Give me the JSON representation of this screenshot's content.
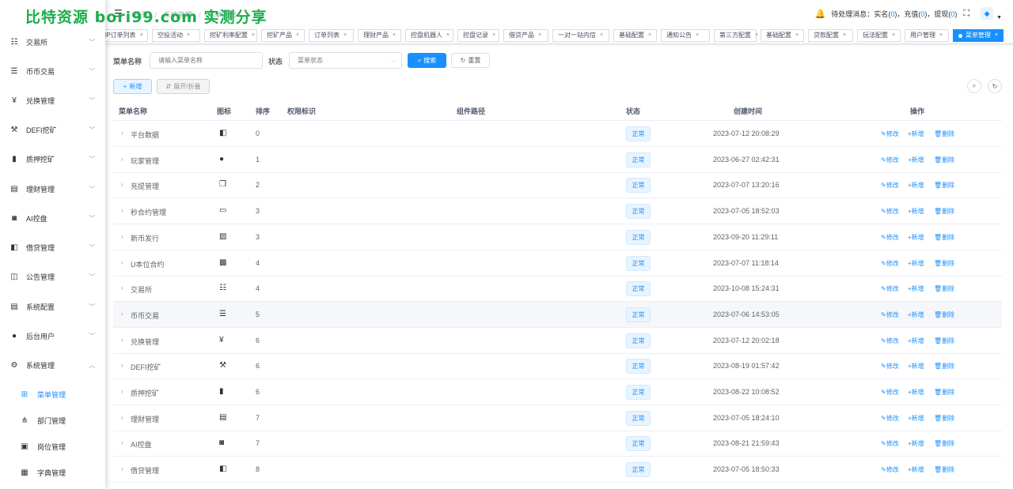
{
  "watermark": "比特资源 bori99.com 实测分享",
  "topbar": {
    "breadcrumb": [
      "首页",
      "系统管理",
      "菜单管理"
    ],
    "pending_label": "待处理消息：",
    "realname_label": "实名(",
    "realname_count": "0",
    "recharge_label": "充值(",
    "recharge_count": "0",
    "withdraw_label": "提现(",
    "withdraw_count": "0",
    "avatar_text": "头像"
  },
  "sidebar": {
    "items": [
      {
        "label": "交易所",
        "icon": "list-icon"
      },
      {
        "label": "币币交易",
        "icon": "list-bullet-icon"
      },
      {
        "label": "兑换管理",
        "icon": "yen-icon"
      },
      {
        "label": "DEFI挖矿",
        "icon": "miner-icon"
      },
      {
        "label": "质押挖矿",
        "icon": "bar-chart-icon"
      },
      {
        "label": "理财管理",
        "icon": "document-icon"
      },
      {
        "label": "AI控盘",
        "icon": "robot-icon"
      },
      {
        "label": "借贷管理",
        "icon": "book-icon"
      },
      {
        "label": "公告管理",
        "icon": "open-book-icon"
      },
      {
        "label": "系统配置",
        "icon": "document-icon"
      },
      {
        "label": "后台用户",
        "icon": "user-icon"
      },
      {
        "label": "系统管理",
        "icon": "gear-icon"
      }
    ],
    "sub_items": [
      {
        "label": "菜单管理",
        "icon": "tree-icon"
      },
      {
        "label": "部门管理",
        "icon": "org-icon"
      },
      {
        "label": "岗位管理",
        "icon": "post-icon"
      },
      {
        "label": "字典管理",
        "icon": "dict-icon"
      }
    ]
  },
  "tags": [
    "IP订单列表",
    "空投活动",
    "挖矿利率配置",
    "挖矿产品",
    "订单列表",
    "理财产品",
    "控盘机器人",
    "控盘记录",
    "借贷产品",
    "一对一站内信",
    "基础配置",
    "通知公告",
    "第三方配置",
    "基础配置",
    "贷款配置",
    "玩法配置",
    "用户管理",
    "菜单管理"
  ],
  "filter": {
    "name_label": "菜单名称",
    "name_placeholder": "请输入菜单名称",
    "status_label": "状态",
    "status_placeholder": "菜单状态",
    "search_label": "搜索",
    "reset_label": "重置"
  },
  "toolbar": {
    "add_label": "新增",
    "expand_label": "展开/折叠"
  },
  "table": {
    "headers": [
      "菜单名称",
      "图标",
      "排序",
      "权限标识",
      "组件路径",
      "状态",
      "创建时间",
      "操作"
    ],
    "op_edit": "修改",
    "op_add": "新增",
    "op_delete": "删除",
    "rows": [
      {
        "name": "平台数据",
        "icon": "book-icon",
        "order": "0",
        "status": "正常",
        "created": "2023-07-12 20:08:29"
      },
      {
        "name": "玩家管理",
        "icon": "user-icon",
        "order": "1",
        "status": "正常",
        "created": "2023-06-27 02:42:31"
      },
      {
        "name": "充提管理",
        "icon": "copy-icon",
        "order": "2",
        "status": "正常",
        "created": "2023-07-07 13:20:16"
      },
      {
        "name": "秒合约管理",
        "icon": "monitor-icon",
        "order": "3",
        "status": "正常",
        "created": "2023-07-05 18:52:03"
      },
      {
        "name": "新币发行",
        "icon": "image-icon",
        "order": "3",
        "status": "正常",
        "created": "2023-09-20 11:29:11"
      },
      {
        "name": "U本位合约",
        "icon": "grid-icon",
        "order": "4",
        "status": "正常",
        "created": "2023-07-07 11:18:14"
      },
      {
        "name": "交易所",
        "icon": "list-icon",
        "order": "4",
        "status": "正常",
        "created": "2023-10-08 15:24:31"
      },
      {
        "name": "币币交易",
        "icon": "list-bullet-icon",
        "order": "5",
        "status": "正常",
        "created": "2023-07-06 14:53:05"
      },
      {
        "name": "兑换管理",
        "icon": "yen-icon",
        "order": "6",
        "status": "正常",
        "created": "2023-07-12 20:02:18"
      },
      {
        "name": "DEFI挖矿",
        "icon": "miner-icon",
        "order": "6",
        "status": "正常",
        "created": "2023-08-19 01:57:42"
      },
      {
        "name": "质押挖矿",
        "icon": "bar-chart-icon",
        "order": "6",
        "status": "正常",
        "created": "2023-08-22 10:08:52"
      },
      {
        "name": "理财管理",
        "icon": "document-icon",
        "order": "7",
        "status": "正常",
        "created": "2023-07-05 18:24:10"
      },
      {
        "name": "AI控盘",
        "icon": "robot-icon",
        "order": "7",
        "status": "正常",
        "created": "2023-08-21 21:59:43"
      },
      {
        "name": "借贷管理",
        "icon": "book-icon",
        "order": "8",
        "status": "正常",
        "created": "2023-07-05 18:50:33"
      }
    ]
  },
  "colors": {
    "accent": "#1890ff",
    "watermark": "#1aae4a"
  }
}
